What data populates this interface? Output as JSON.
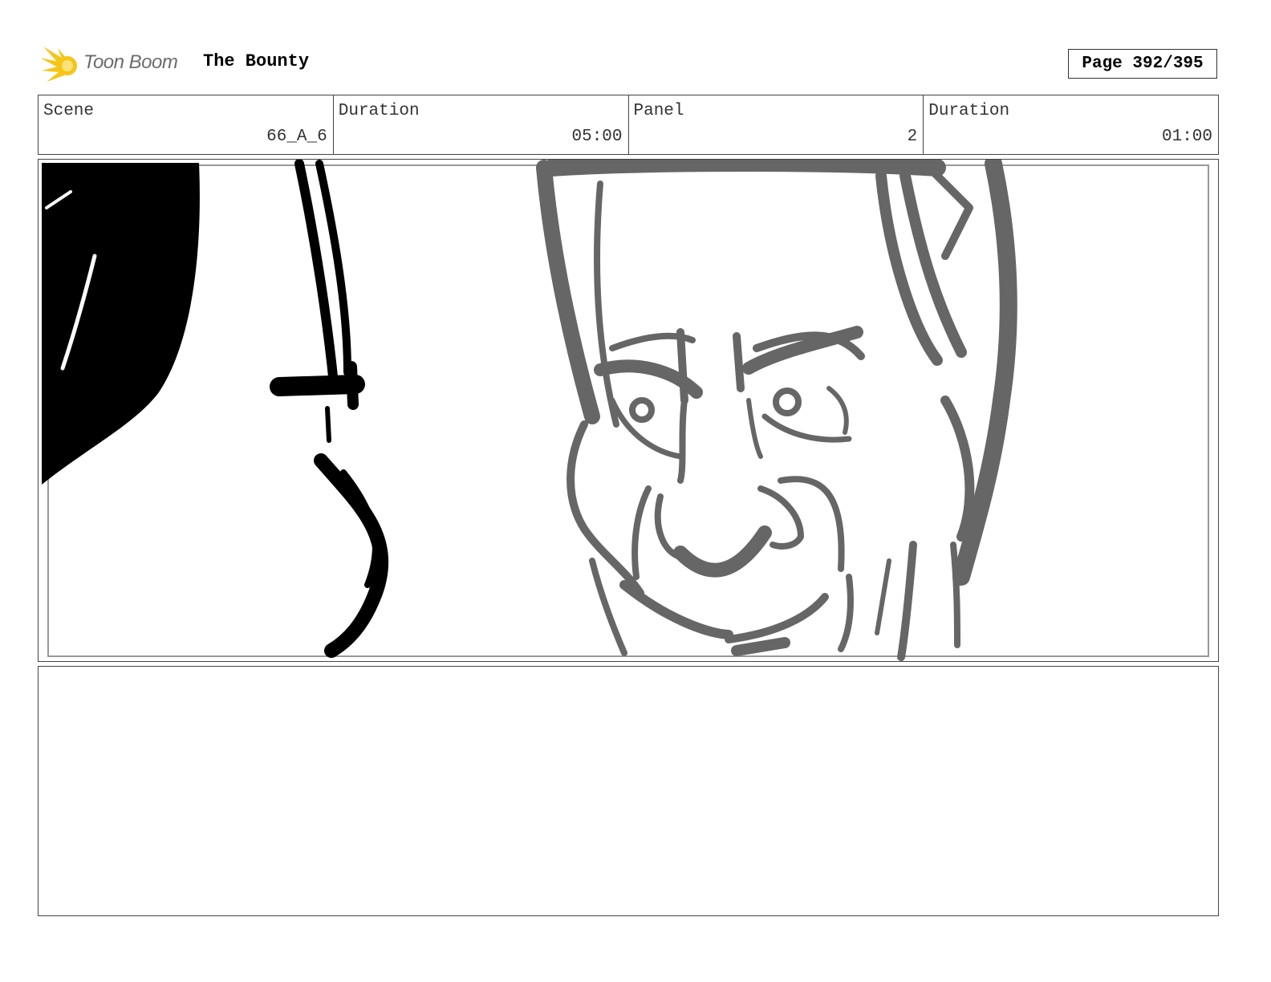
{
  "header": {
    "logo_text": "Toon Boom",
    "project_title": "The Bounty",
    "page_label": "Page",
    "page_number": "392/395"
  },
  "info": {
    "scene_label": "Scene",
    "scene_value": "66_A_6",
    "scene_duration_label": "Duration",
    "scene_duration_value": "05:00",
    "panel_label": "Panel",
    "panel_value": "2",
    "panel_duration_label": "Duration",
    "panel_duration_value": "01:00"
  },
  "colors": {
    "logo_accent": "#f5c518",
    "foreground_sketch": "#000000",
    "background_sketch": "#666666"
  },
  "notes": {
    "text": ""
  }
}
